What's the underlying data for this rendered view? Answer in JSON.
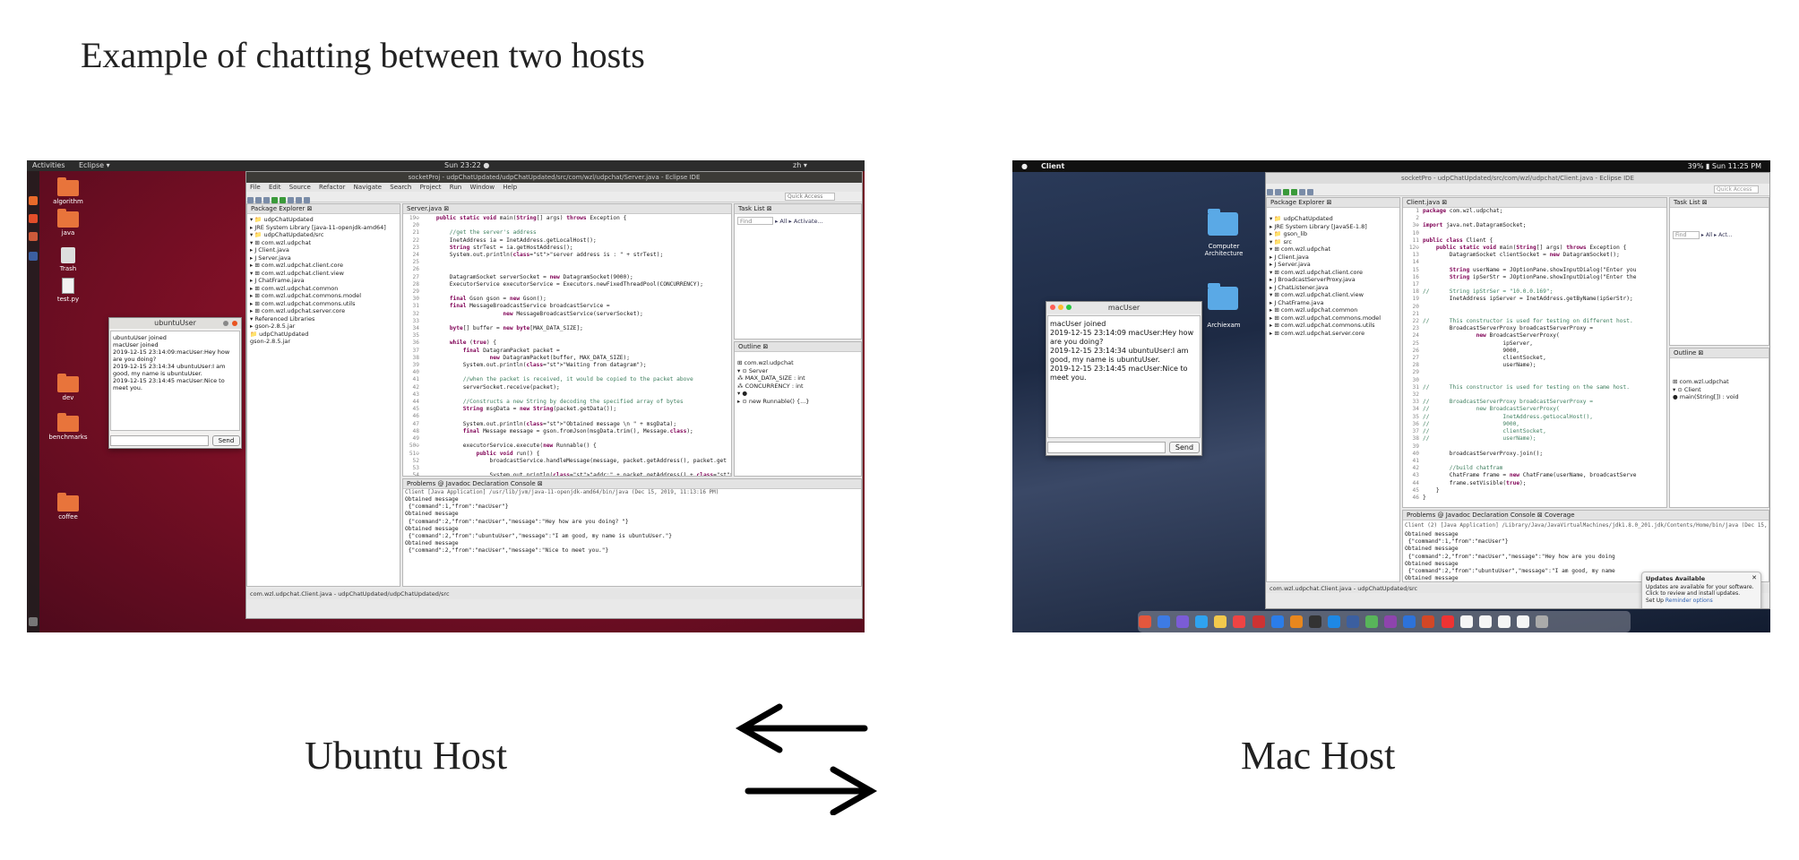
{
  "title": "Example of chatting between two hosts",
  "captions": {
    "ubuntu": "Ubuntu Host",
    "mac": "Mac Host"
  },
  "ubuntu": {
    "topbar": {
      "activities": "Activities",
      "app": "Eclipse ▾",
      "clock": "Sun 23:22 ●",
      "lang": "zh ▾"
    },
    "desktop_icons": [
      "algorithm",
      "java",
      "Trash",
      "test.py",
      "dev",
      "benchmarks",
      "coffee"
    ],
    "eclipse": {
      "title": "socketProj - udpChatUpdated/udpChatUpdated/src/com/wzl/udpchat/Server.java - Eclipse IDE",
      "menu": [
        "File",
        "Edit",
        "Source",
        "Refactor",
        "Navigate",
        "Search",
        "Project",
        "Run",
        "Window",
        "Help"
      ],
      "quick_access": "Quick Access",
      "package_explorer_tab": "Package Explorer ⊠",
      "tree": [
        "▾ 📁 udpChatUpdated",
        "  ▸ JRE System Library [java-11-openjdk-amd64]",
        "  ▾ 📁 udpChatUpdated/src",
        "    ▾ ⊞ com.wzl.udpchat",
        "      ▸ J Client.java",
        "      ▸ J Server.java",
        "    ▸ ⊞ com.wzl.udpchat.client.core",
        "    ▾ ⊞ com.wzl.udpchat.client.view",
        "      ▸ J ChatFrame.java",
        "    ▸ ⊞ com.wzl.udpchat.common",
        "    ▸ ⊞ com.wzl.udpchat.commons.model",
        "    ▸ ⊞ com.wzl.udpchat.commons.utils",
        "    ▸ ⊞ com.wzl.udpchat.server.core",
        "  ▾ Referenced Libraries",
        "    ▸ gson-2.8.5.jar",
        "📁 udpChatUpdated",
        "gson-2.8.5.jar"
      ],
      "editor_tab": "Server.java ⊠",
      "code": [
        {
          "n": "19⊖",
          "t": "    public static void main(String[] args) throws Exception {"
        },
        {
          "n": "20",
          "t": ""
        },
        {
          "n": "21",
          "t": "        //get the server's address"
        },
        {
          "n": "22",
          "t": "        InetAddress ia = InetAddress.getLocalHost();"
        },
        {
          "n": "23",
          "t": "        String strTest = ia.getHostAddress();"
        },
        {
          "n": "24",
          "t": "        System.out.println(\"server address is : \" + strTest);"
        },
        {
          "n": "25",
          "t": ""
        },
        {
          "n": "26",
          "t": ""
        },
        {
          "n": "27",
          "t": "        DatagramSocket serverSocket = new DatagramSocket(9000);"
        },
        {
          "n": "28",
          "t": "        ExecutorService executorService = Executors.newFixedThreadPool(CONCURRENCY);"
        },
        {
          "n": "29",
          "t": ""
        },
        {
          "n": "30",
          "t": "        final Gson gson = new Gson();"
        },
        {
          "n": "31",
          "t": "        final MessageBroadcastService broadcastService ="
        },
        {
          "n": "32",
          "t": "                        new MessageBroadcastService(serverSocket);"
        },
        {
          "n": "33",
          "t": ""
        },
        {
          "n": "34",
          "t": "        byte[] buffer = new byte[MAX_DATA_SIZE];"
        },
        {
          "n": "35",
          "t": ""
        },
        {
          "n": "36",
          "t": "        while (true) {"
        },
        {
          "n": "37",
          "t": "            final DatagramPacket packet ="
        },
        {
          "n": "38",
          "t": "                    new DatagramPacket(buffer, MAX_DATA_SIZE);"
        },
        {
          "n": "39",
          "t": "            System.out.println(\"Waiting from datagram\");"
        },
        {
          "n": "40",
          "t": ""
        },
        {
          "n": "41",
          "t": "            //when the packet is received, it would be copied to the packet above"
        },
        {
          "n": "42",
          "t": "            serverSocket.receive(packet);"
        },
        {
          "n": "43",
          "t": ""
        },
        {
          "n": "44",
          "t": "            //Constructs a new String by decoding the specified array of bytes"
        },
        {
          "n": "45",
          "t": "            String msgData = new String(packet.getData());"
        },
        {
          "n": "46",
          "t": ""
        },
        {
          "n": "47",
          "t": "            System.out.println(\"Obtained message \\n \" + msgData);"
        },
        {
          "n": "48",
          "t": "            final Message message = gson.fromJson(msgData.trim(), Message.class);"
        },
        {
          "n": "49",
          "t": ""
        },
        {
          "n": "50⊖",
          "t": "            executorService.execute(new Runnable() {"
        },
        {
          "n": "51⊖",
          "t": "                public void run() {"
        },
        {
          "n": "52",
          "t": "                    broadcastService.handleMessage(message, packet.getAddress(), packet.get"
        },
        {
          "n": "53",
          "t": ""
        },
        {
          "n": "54",
          "t": "                    System.out.println(\"addr:\" + packet.getAddress() + \"port: \" + packet.ge"
        }
      ],
      "task_list_tab": "Task List ⊠",
      "find": "Find",
      "all": "▸ All",
      "activate": "▸ Activate...",
      "outline_tab": "Outline ⊠",
      "outline": [
        "⊞ com.wzl.udpchat",
        "▾ ⊙ Server",
        "    ⁂ MAX_DATA_SIZE : int",
        "    ⁂ CONCURRENCY : int",
        "  ▾ ●",
        "    ▸ ⊙ new Runnable() {...}"
      ],
      "console_tabs": "Problems  @ Javadoc  Declaration  Console ⊠",
      "console_header": "Client [Java Application] /usr/lib/jvm/java-11-openjdk-amd64/bin/java (Dec 15, 2019, 11:13:16 PM)",
      "console": [
        "Obtained message",
        " {\"command\":1,\"from\":\"macUser\"}",
        "Obtained message",
        " {\"command\":2,\"from\":\"macUser\",\"message\":\"Hey how are you doing? \"}",
        "Obtained message",
        " {\"command\":2,\"from\":\"ubuntuUser\",\"message\":\"I am good, my name is ubuntuUser.\"}",
        "Obtained message",
        " {\"command\":2,\"from\":\"macUser\",\"message\":\"Nice to meet you.\"}"
      ],
      "status": "com.wzl.udpchat.Client.java - udpChatUpdated/udpChatUpdated/src"
    },
    "chat": {
      "title": "ubuntuUser",
      "text": "ubuntuUser joined\nmacUser joined\n2019-12-15 23:14:09:macUser:Hey how are you doing?\n2019-12-15 23:14:34 ubuntuUser:I am good, my name is ubuntuUser.\n2019-12-15 23:14:45 macUser:Nice to meet you.",
      "send": "Send"
    }
  },
  "mac": {
    "menubar": {
      "app": "Client",
      "status": "39% ▮  Sun 11:25 PM"
    },
    "desktop_icons": [
      "Computer Architecture",
      "Archiexam"
    ],
    "eclipse": {
      "title": "socketPro - udpChatUpdated/src/com/wzl/udpchat/Client.java - Eclipse IDE",
      "quick_access": "Quick Access",
      "package_explorer_tab": "Package Explorer ⊠",
      "tree": [
        "▾ 📁 udpChatUpdated",
        "  ▸ JRE System Library [JavaSE-1.8]",
        "  ▸ 📁 gson_lib",
        "  ▾ 📁 src",
        "    ▾ ⊞ com.wzl.udpchat",
        "      ▸ J Client.java",
        "      ▸ J Server.java",
        "    ▾ ⊞ com.wzl.udpchat.client.core",
        "      ▸ J BroadcastServerProxy.java",
        "      ▸ J ChatListener.java",
        "    ▾ ⊞ com.wzl.udpchat.client.view",
        "      ▸ J ChatFrame.java",
        "    ▸ ⊞ com.wzl.udpchat.common",
        "    ▸ ⊞ com.wzl.udpchat.commons.model",
        "    ▸ ⊞ com.wzl.udpchat.commons.utils",
        "    ▸ ⊞ com.wzl.udpchat.server.core"
      ],
      "editor_tab": "Client.java ⊠",
      "code": [
        {
          "n": "1",
          "t": "package com.wzl.udpchat;"
        },
        {
          "n": "2",
          "t": ""
        },
        {
          "n": "3⊕",
          "t": "import java.net.DatagramSocket;"
        },
        {
          "n": "10",
          "t": ""
        },
        {
          "n": "11",
          "t": "public class Client {"
        },
        {
          "n": "12⊖",
          "t": "    public static void main(String[] args) throws Exception {"
        },
        {
          "n": "13",
          "t": "        DatagramSocket clientSocket = new DatagramSocket();"
        },
        {
          "n": "14",
          "t": ""
        },
        {
          "n": "15",
          "t": "        String userName = JOptionPane.showInputDialog(\"Enter you"
        },
        {
          "n": "16",
          "t": "        String ipSerStr = JOptionPane.showInputDialog(\"Enter the"
        },
        {
          "n": "17",
          "t": ""
        },
        {
          "n": "18",
          "t": "//      String ipStrSer = \"10.0.0.169\";"
        },
        {
          "n": "19",
          "t": "        InetAddress ipServer = InetAddress.getByName(ipSerStr);"
        },
        {
          "n": "20",
          "t": ""
        },
        {
          "n": "21",
          "t": ""
        },
        {
          "n": "22",
          "t": "//      This constructor is used for testing on different host."
        },
        {
          "n": "23",
          "t": "        BroadcastServerProxy broadcastServerProxy ="
        },
        {
          "n": "24",
          "t": "                new BroadcastServerProxy("
        },
        {
          "n": "25",
          "t": "                        ipServer,"
        },
        {
          "n": "26",
          "t": "                        9000,"
        },
        {
          "n": "27",
          "t": "                        clientSocket,"
        },
        {
          "n": "28",
          "t": "                        userName);"
        },
        {
          "n": "29",
          "t": ""
        },
        {
          "n": "30",
          "t": ""
        },
        {
          "n": "31",
          "t": "//      This constructor is used for testing on the same host."
        },
        {
          "n": "32",
          "t": ""
        },
        {
          "n": "33",
          "t": "//      BroadcastServerProxy broadcastServerProxy ="
        },
        {
          "n": "34",
          "t": "//              new BroadcastServerProxy("
        },
        {
          "n": "35",
          "t": "//                      InetAddress.getLocalHost(),"
        },
        {
          "n": "36",
          "t": "//                      9000,"
        },
        {
          "n": "37",
          "t": "//                      clientSocket,"
        },
        {
          "n": "38",
          "t": "//                      userName);"
        },
        {
          "n": "39",
          "t": ""
        },
        {
          "n": "40",
          "t": "        broadcastServerProxy.join();"
        },
        {
          "n": "41",
          "t": ""
        },
        {
          "n": "42",
          "t": "        //build chatfram"
        },
        {
          "n": "43",
          "t": "        ChatFrame frame = new ChatFrame(userName, broadcastServe"
        },
        {
          "n": "44",
          "t": "        frame.setVisible(true);"
        },
        {
          "n": "45",
          "t": "    }"
        },
        {
          "n": "46",
          "t": "}"
        }
      ],
      "task_list_tab": "Task List ⊠",
      "find": "Find",
      "all": "▸ All  ▸ Act...",
      "outline_tab": "Outline ⊠",
      "outline": [
        "⊞ com.wzl.udpchat",
        "▾ ⊙ Client",
        "    ● main(String[]) : void"
      ],
      "console_tabs": "Problems  @ Javadoc  Declaration  Console ⊠  Coverage",
      "console_header": "Client (2) [Java Application] /Library/Java/JavaVirtualMachines/jdk1.8.0_201.jdk/Contents/Home/bin/java (Dec 15, 2019, 11:13:44",
      "console": [
        "Obtained message",
        " {\"command\":1,\"from\":\"macUser\"}",
        "Obtained message",
        " {\"command\":2,\"from\":\"macUser\",\"message\":\"Hey how are you doing",
        "Obtained message",
        " {\"command\":2,\"from\":\"ubuntuUser\",\"message\":\"I am good, my name",
        "Obtained message"
      ],
      "status": "com.wzl.udpchat.Client.java - udpChatUpdated/src"
    },
    "chat": {
      "title": "macUser",
      "text": "macUser joined\n2019-12-15 23:14:09 macUser:Hey how are you doing?\n2019-12-15 23:14:34 ubuntuUser:I am good, my name is ubuntuUser.\n2019-12-15 23:14:45 macUser:Nice to meet you.",
      "send": "Send"
    },
    "notification": {
      "title": "Updates Available",
      "body": "Updates are available for your software. Click to review and install updates.",
      "setup": "Set Up",
      "reminder": "Reminder options"
    }
  },
  "colors": {
    "ubuntu_bg": "#7a0f25",
    "mac_bg": "#1d2a44",
    "ubuntu_accent": "#e8743b",
    "mac_folder": "#5aa9e6"
  }
}
